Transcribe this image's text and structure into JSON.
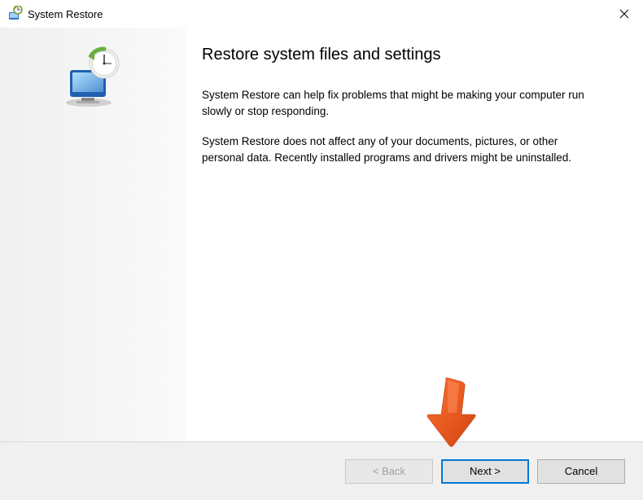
{
  "window": {
    "title": "System Restore"
  },
  "content": {
    "heading": "Restore system files and settings",
    "paragraph1": "System Restore can help fix problems that might be making your computer run slowly or stop responding.",
    "paragraph2": "System Restore does not affect any of your documents, pictures, or other personal data. Recently installed programs and drivers might be uninstalled."
  },
  "buttons": {
    "back": "< Back",
    "next": "Next >",
    "cancel": "Cancel"
  }
}
